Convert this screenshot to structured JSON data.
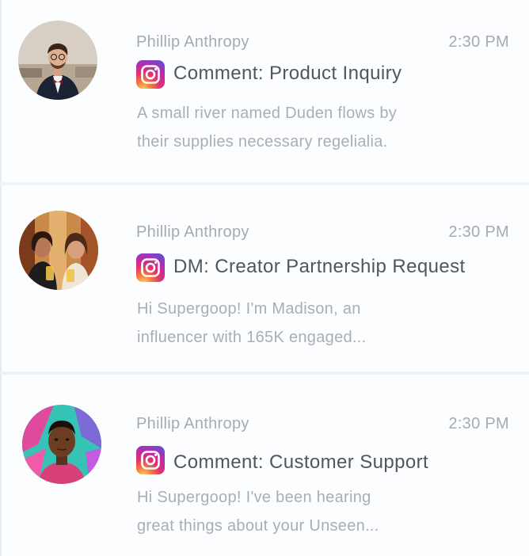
{
  "messages": [
    {
      "sender": "Phillip Anthropy",
      "time": "2:30 PM",
      "channel_icon": "instagram-icon",
      "subject": "Comment: Product Inquiry",
      "preview_lines": [
        "A small river named Duden flows by",
        "their supplies necessary regelialia."
      ],
      "avatar": "man-in-tuxedo-avatar"
    },
    {
      "sender": "Phillip Anthropy",
      "time": "2:30 PM",
      "channel_icon": "instagram-icon",
      "subject": "DM: Creator Partnership Request",
      "preview_lines": [
        "Hi Supergoop! I'm Madison, an",
        "influencer with 165K engaged..."
      ],
      "avatar": "two-women-avatar"
    },
    {
      "sender": "Phillip Anthropy",
      "time": "2:30 PM",
      "channel_icon": "instagram-icon",
      "subject": "Comment: Customer Support",
      "preview_lines": [
        "Hi Supergoop! I've been hearing",
        "great things about your Unseen..."
      ],
      "avatar": "man-colorful-background-avatar"
    }
  ],
  "colors": {
    "sender_time": "#a6abb3",
    "subject": "#4f5660",
    "preview": "#a9aeb5",
    "separator": "#edf3f8"
  }
}
